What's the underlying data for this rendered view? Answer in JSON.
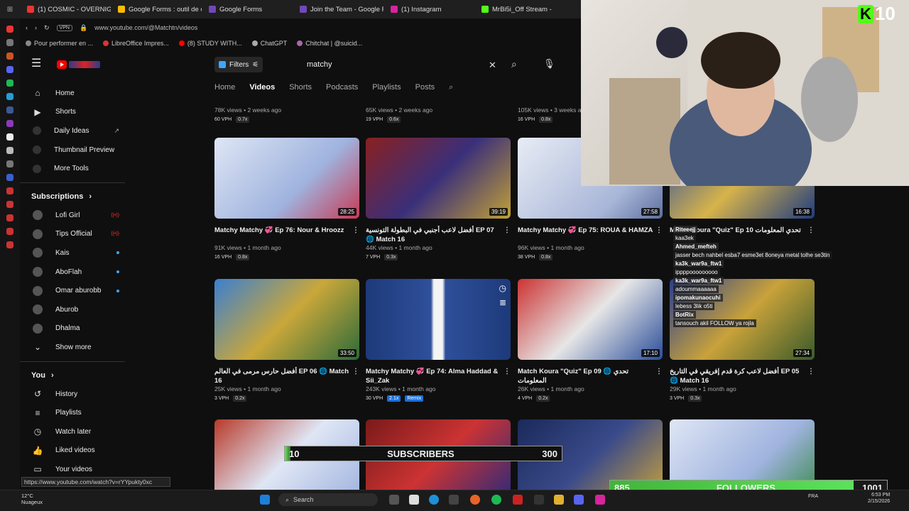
{
  "browser": {
    "tabs": [
      {
        "label": "(1) COSMIC - OVERNIGHT",
        "color": "#e33"
      },
      {
        "label": "Google Forms : outil de cr",
        "color": "#fbbc05"
      },
      {
        "label": "Google Forms",
        "color": "#7248b9"
      },
      {
        "label": "Join the Team - Google F",
        "color": "#7248b9"
      },
      {
        "label": "(1) Instagram",
        "color": "#d6249f"
      },
      {
        "label": "MrBi5i_Off Stream - Watc",
        "color": "#53fc18"
      }
    ],
    "vpn": "VPN",
    "url": "www.youtube.com/@Matchtn/videos",
    "bookmarks": [
      {
        "label": "Pour performer en ...",
        "color": "#888"
      },
      {
        "label": "LibreOffice Impres...",
        "color": "#d33"
      },
      {
        "label": "(8) STUDY WITH...",
        "color": "#f00"
      },
      {
        "label": "ChatGPT",
        "color": "#aaa"
      },
      {
        "label": "Chitchat | @suicid...",
        "color": "#a6a"
      }
    ]
  },
  "header": {
    "filters_label": "Filters",
    "search_value": "matchy",
    "channel_tabs": [
      "Home",
      "Videos",
      "Shorts",
      "Podcasts",
      "Playlists",
      "Posts"
    ],
    "active_tab": "Videos"
  },
  "sidebar": {
    "top": [
      {
        "label": "Home",
        "icon": "home-icon",
        "glyph": "⌂"
      },
      {
        "label": "Shorts",
        "icon": "shorts-icon",
        "glyph": "▶"
      }
    ],
    "extras": [
      {
        "label": "Daily Ideas"
      },
      {
        "label": "Thumbnail Preview"
      },
      {
        "label": "More Tools"
      }
    ],
    "external_glyph": "↗",
    "subscriptions_title": "Subscriptions",
    "subscriptions": [
      {
        "label": "Lofi Girl",
        "marker": "live"
      },
      {
        "label": "Tips Official",
        "marker": "live"
      },
      {
        "label": "Kais",
        "marker": "dot"
      },
      {
        "label": "AboFlah",
        "marker": "dot"
      },
      {
        "label": "Omar aburobb",
        "marker": "dot"
      },
      {
        "label": "Aburob",
        "marker": "none"
      },
      {
        "label": "Dhalma",
        "marker": "none"
      }
    ],
    "live_glyph": "((•))",
    "show_more": "Show more",
    "you_title": "You",
    "you": [
      {
        "label": "History",
        "glyph": "↺"
      },
      {
        "label": "Playlists",
        "glyph": "≡"
      },
      {
        "label": "Watch later",
        "glyph": "◷"
      },
      {
        "label": "Liked videos",
        "glyph": "👍"
      },
      {
        "label": "Your videos",
        "glyph": "▭"
      }
    ]
  },
  "top_row": [
    {
      "meta": "78K views • 2 weeks ago",
      "vph": "60 VPH",
      "ratio": "0.7x"
    },
    {
      "meta": "65K views • 2 weeks ago",
      "vph": "19 VPH",
      "ratio": "0.6x"
    },
    {
      "meta": "105K views • 3 weeks ag",
      "vph": "16 VPH",
      "ratio": "0.8x"
    }
  ],
  "videos": [
    {
      "title": "Matchy Matchy 💞 Ep 76: Nour & Hroozz",
      "meta": "91K views • 1 month ago",
      "vph": "16 VPH",
      "ratio": "0.8x",
      "duration": "28:25",
      "thumb": "linear-gradient(135deg,#dfe6f5,#9fb3de 60%,#c63b55)",
      "badges": []
    },
    {
      "title": "أفضل لاعب أجنبي في البطولة التونسية EP 07 🌐 Match 16",
      "meta": "44K views • 1 month ago",
      "vph": "7 VPH",
      "ratio": "0.3x",
      "duration": "39:19",
      "thumb": "linear-gradient(135deg,#8a2020,#3a2f7a 50%,#c2a037)",
      "badges": []
    },
    {
      "title": "Matchy Matchy 💞 Ep 75: ROUA & HAMZA",
      "meta": "96K views • 1 month ago",
      "vph": "38 VPH",
      "ratio": "0.8x",
      "duration": "27:58",
      "thumb": "linear-gradient(135deg,#e8ecf5,#a8b6d8 70%,#5d6f9e)",
      "badges": []
    },
    {
      "title": "Match Koura \"Quiz\" Ep 10 تحدي المعلومات",
      "meta": "",
      "vph": "",
      "ratio": "",
      "duration": "16:38",
      "thumb": "linear-gradient(135deg,#2b4da0,#d7b34a 50%,#1f3c80)",
      "badges": []
    },
    {
      "title": "أفضل حارس مرمى في العالم EP 06 🌐 Match 16",
      "meta": "25K views • 1 month ago",
      "vph": "3 VPH",
      "ratio": "0.2x",
      "duration": "33:50",
      "thumb": "linear-gradient(135deg,#3b7fd0,#c9a73a 50%,#2c6a3a)",
      "badges": []
    },
    {
      "title": "Matchy Matchy 💞 Ep 74: Alma Haddad & Sii_Zak",
      "meta": "243K views • 1 month ago",
      "vph": "30 VPH",
      "ratio": "2.1x",
      "duration": "",
      "thumb": "linear-gradient(90deg,#1d3a7a 0%,#2e4f9a 45%,#f4f4f4 47%,#f4f4f4 53%,#2e4f9a 55%,#1d3a7a 100%)",
      "badges": [
        "Remix"
      ]
    },
    {
      "title": "Match Koura \"Quiz\" Ep 09 🌐 تحدي المعلومات",
      "meta": "26K views • 1 month ago",
      "vph": "4 VPH",
      "ratio": "0.2x",
      "duration": "17:10",
      "thumb": "linear-gradient(135deg,#c33,#e6e6e6 50%,#2a4d9a)",
      "badges": []
    },
    {
      "title": "أفضل لاعب كرة قدم إفريقي في التاريخ EP 05 🌐 Match 16",
      "meta": "29K views • 1 month ago",
      "vph": "3 VPH",
      "ratio": "0.3x",
      "duration": "27:34",
      "thumb": "linear-gradient(135deg,#2a3f8f,#c9a23a 50%,#3a5a2a)",
      "badges": []
    },
    {
      "title": "",
      "meta": "",
      "vph": "",
      "ratio": "",
      "duration": "",
      "thumb": "linear-gradient(135deg,#b83a2a,#dfe6f5 50%,#9fb3de)",
      "badges": []
    },
    {
      "title": "",
      "meta": "",
      "vph": "",
      "ratio": "",
      "duration": "",
      "thumb": "linear-gradient(135deg,#7a1a1a,#c33 50%,#2a2a7a)",
      "badges": []
    },
    {
      "title": "",
      "meta": "",
      "vph": "",
      "ratio": "",
      "duration": "",
      "thumb": "linear-gradient(135deg,#1a2a5a,#3a4a8a 50%,#c9a23a)",
      "badges": []
    },
    {
      "title": "",
      "meta": "",
      "vph": "",
      "ratio": "",
      "duration": "",
      "thumb": "linear-gradient(135deg,#dfe6f5,#9fb3de 60%,#3a8a4a)",
      "badges": []
    }
  ],
  "chat": [
    {
      "user": "Riteeejj",
      "text": ""
    },
    {
      "user": "",
      "text": "kaa3ek"
    },
    {
      "user": "Ahmed_mefteh",
      "text": ""
    },
    {
      "user": "",
      "text": "jasser bech nahbel esba7 esme3et 8oneya metal tolhe se3tin"
    },
    {
      "user": "ka3k_war9a_ftw1",
      "text": ""
    },
    {
      "user": "",
      "text": "ippppooooooooo"
    },
    {
      "user": "ka3k_war9a_ftw1",
      "text": ""
    },
    {
      "user": "",
      "text": "adoummaaaaaa"
    },
    {
      "user": "ipomakunaocuhi",
      "text": ""
    },
    {
      "user": "",
      "text": "lebess 3lik o5ti"
    },
    {
      "user": "BotRix",
      "text": ""
    },
    {
      "user": "",
      "text": "tansouch akil FOLLOW ya rojla"
    }
  ],
  "overlay": {
    "kick_logo": "K",
    "viewer_count": "10",
    "subs_current": "10",
    "subs_label": "SUBSCRIBERS",
    "subs_goal": "300",
    "followers_current": "885",
    "followers_label": "FOLLOWERS",
    "followers_goal": "1001"
  },
  "status_url": "https://www.youtube.com/watch?v=rYYpukty0xc",
  "taskbar": {
    "temp": "12°C",
    "weather": "Nuageux",
    "search": "Search",
    "lang": "FRA",
    "time": "6:53 PM",
    "date": "2/15/2026"
  }
}
